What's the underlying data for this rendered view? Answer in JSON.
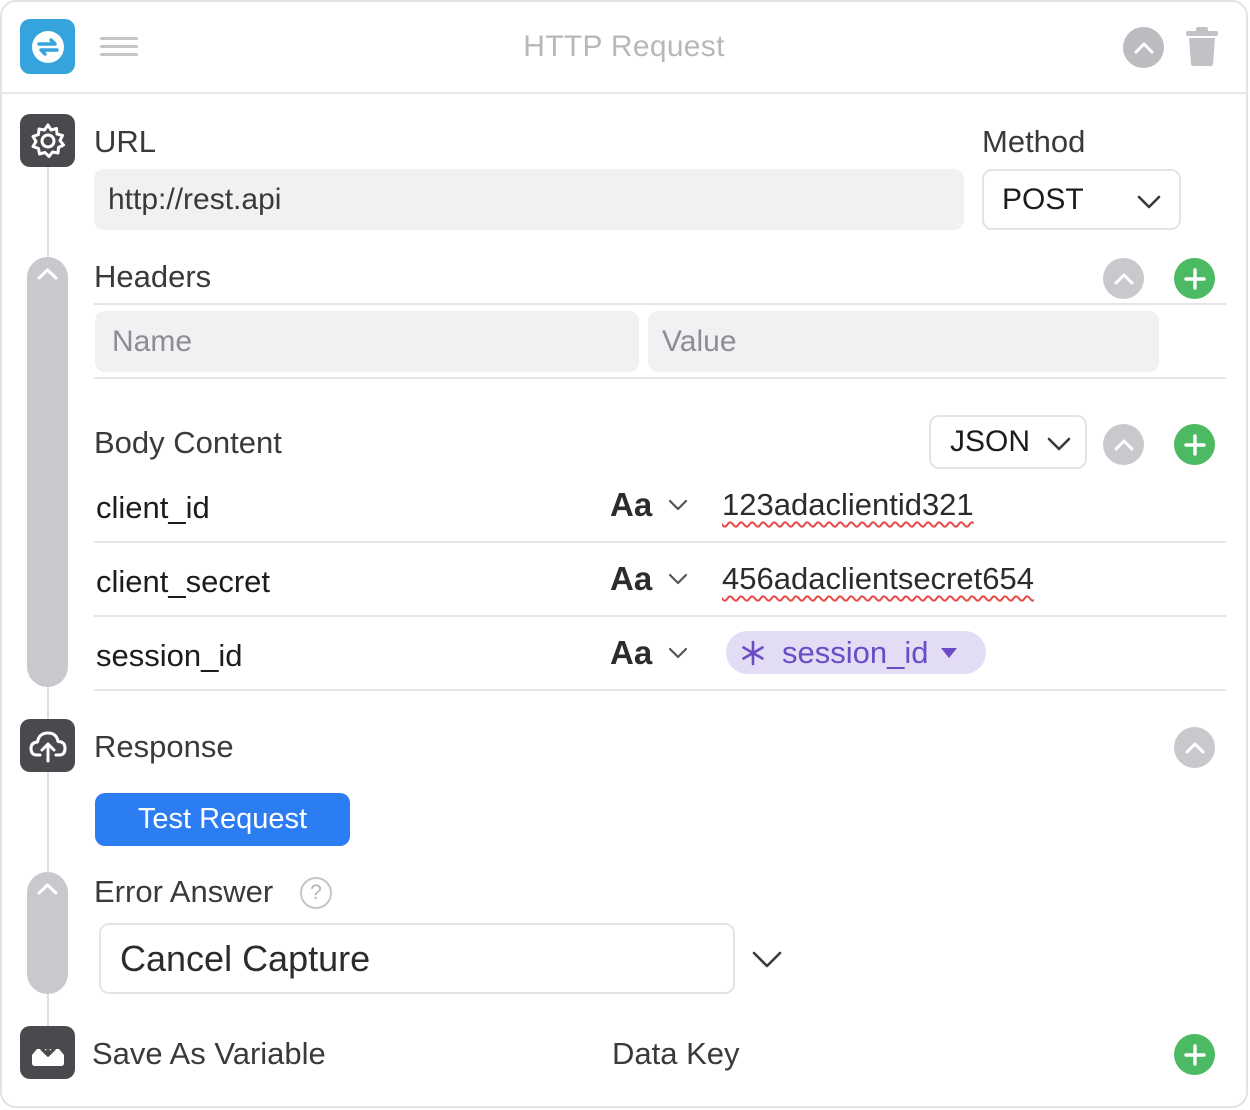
{
  "header": {
    "title": "HTTP Request"
  },
  "request": {
    "url_label": "URL",
    "url_value": "http://rest.api",
    "method_label": "Method",
    "method_value": "POST"
  },
  "headers": {
    "label": "Headers",
    "name_placeholder": "Name",
    "value_placeholder": "Value"
  },
  "body": {
    "label": "Body Content",
    "format": "JSON",
    "rows": [
      {
        "key": "client_id",
        "type": "Aa",
        "value": "123adaclientid321"
      },
      {
        "key": "client_secret",
        "type": "Aa",
        "value": "456adaclientsecret654"
      },
      {
        "key": "session_id",
        "type": "Aa",
        "token": "session_id"
      }
    ]
  },
  "response": {
    "label": "Response",
    "test_button": "Test Request"
  },
  "error": {
    "label": "Error Answer",
    "help": "?",
    "value": "Cancel Capture"
  },
  "save": {
    "label": "Save As Variable",
    "data_key_label": "Data Key"
  },
  "colors": {
    "app_icon": "#35a4dd",
    "accent_blue": "#2d7df2",
    "add_green": "#4cb963",
    "token_bg": "#e3dcf5",
    "token_text": "#6a4cc5"
  },
  "icons": [
    "refresh-icon",
    "hamburger-icon",
    "chevron-up-icon",
    "trash-icon",
    "gear-icon",
    "plus-icon",
    "chevron-down-icon",
    "cloud-upload-icon",
    "download-tray-icon",
    "asterisk-icon",
    "caret-down-icon",
    "help-icon"
  ]
}
